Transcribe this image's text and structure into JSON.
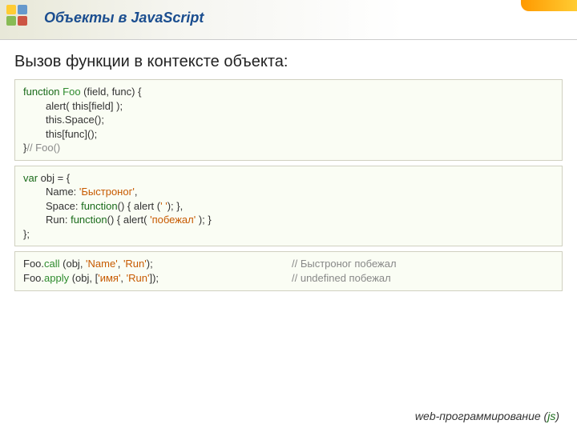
{
  "header": {
    "title": "Объекты в JavaScript"
  },
  "subtitle": "Вызов функции в контексте объекта:",
  "code1": {
    "l1a": "function",
    "l1b": " Foo ",
    "l1c": "(field, func) {",
    "l2": "alert( this[field] );",
    "l3": "this.Space();",
    "l4": "this[func]();",
    "l5a": "}",
    "l5b": "// Foo()"
  },
  "code2": {
    "l1a": "var",
    "l1b": " obj = {",
    "l2a": "Name: ",
    "l2b": "'Быстроног'",
    "l2c": ",",
    "l3a": "Space: ",
    "l3b": "function",
    "l3c": "() { alert (",
    "l3d": "' '",
    "l3e": "); },",
    "l4a": "Run: ",
    "l4b": "function",
    "l4c": "() { alert( ",
    "l4d": "'побежал'",
    "l4e": " ); }",
    "l5": "};"
  },
  "code3": {
    "l1a": "Foo.",
    "l1b": "call",
    "l1c": " (obj, ",
    "l1d": "'Name'",
    "l1e": ", ",
    "l1f": "'Run'",
    "l1g": ");",
    "l1cmt": "// Быстроног побежал",
    "l2a": "Foo.",
    "l2b": "apply",
    "l2c": " (obj, [",
    "l2d": "'имя'",
    "l2e": ", ",
    "l2f": "'Run'",
    "l2g": "]);",
    "l2cmt": "// undefined побежал"
  },
  "footer": {
    "text": "web-программирование ",
    "paren_open": "(",
    "js": "js",
    "paren_close": ")"
  }
}
